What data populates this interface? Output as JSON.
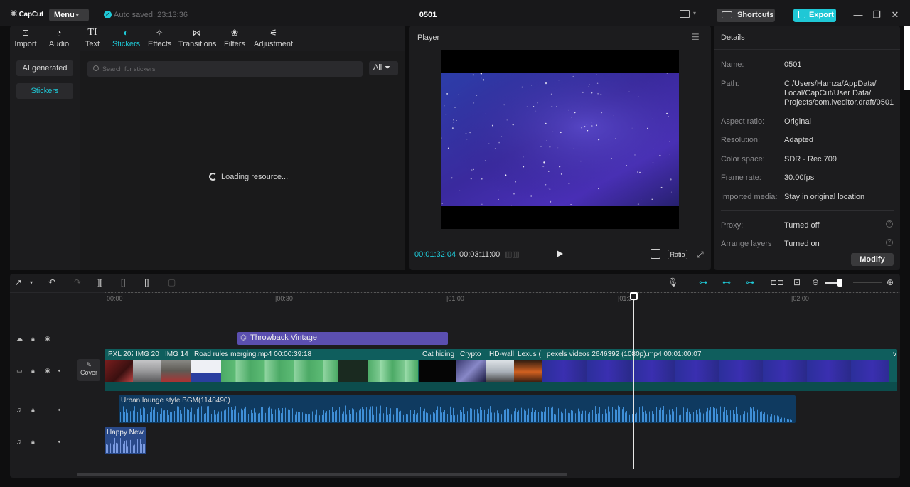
{
  "app": {
    "logo": "CapCut",
    "menu_label": "Menu",
    "autosave": "Auto saved: 23:13:36",
    "project_title": "0501",
    "shortcuts_label": "Shortcuts",
    "export_label": "Export",
    "accent": "#1fc8d6"
  },
  "tool_tabs": [
    {
      "label": "Import",
      "icon": "import-icon"
    },
    {
      "label": "Audio",
      "icon": "audio-icon"
    },
    {
      "label": "Text",
      "icon": "text-icon"
    },
    {
      "label": "Stickers",
      "icon": "stickers-icon",
      "active": true
    },
    {
      "label": "Effects",
      "icon": "effects-icon"
    },
    {
      "label": "Transitions",
      "icon": "transitions-icon"
    },
    {
      "label": "Filters",
      "icon": "filters-icon"
    },
    {
      "label": "Adjustment",
      "icon": "adjustment-icon"
    }
  ],
  "stickers": {
    "categories": [
      "AI generated",
      "Stickers"
    ],
    "search_placeholder": "Search for stickers",
    "filter_label": "All",
    "loading": "Loading resource..."
  },
  "player": {
    "title": "Player",
    "current_time": "00:01:32:04",
    "total_time": "00:03:11:00",
    "ratio_label": "Ratio"
  },
  "details": {
    "title": "Details",
    "fields": [
      {
        "label": "Name:",
        "value": "0501"
      },
      {
        "label": "Path:",
        "value": "C:/Users/Hamza/AppData/",
        "value2": "Local/CapCut/User Data/",
        "value3": "Projects/com.lveditor.draft/0501"
      },
      {
        "label": "Aspect ratio:",
        "value": "Original"
      },
      {
        "label": "Resolution:",
        "value": "Adapted"
      },
      {
        "label": "Color space:",
        "value": "SDR - Rec.709"
      },
      {
        "label": "Frame rate:",
        "value": "30.00fps"
      },
      {
        "label": "Imported media:",
        "value": "Stay in original location"
      },
      {
        "label": "Proxy:",
        "value": "Turned off"
      },
      {
        "label": "Arrange layers",
        "value": "Turned on"
      }
    ],
    "modify_label": "Modify"
  },
  "timeline": {
    "ruler": [
      "00:00",
      "|00:30",
      "|01:00",
      "|01:30",
      "|02:00"
    ],
    "effect_clip": "Throwback Vintage",
    "cover_label": "Cover",
    "video_clips": [
      "PXL 202",
      "IMG 20",
      "IMG 14",
      "Road rules  merging.mp4  00:00:39:18",
      "Cat hiding",
      "Crypto",
      "HD-wall",
      "Lexus (",
      "pexels videos 2646392 (1080p).mp4  00:01:00:07",
      "v"
    ],
    "bgm_clip": "Urban lounge style BGM(1148490)",
    "happy_clip": "Happy New Year"
  }
}
